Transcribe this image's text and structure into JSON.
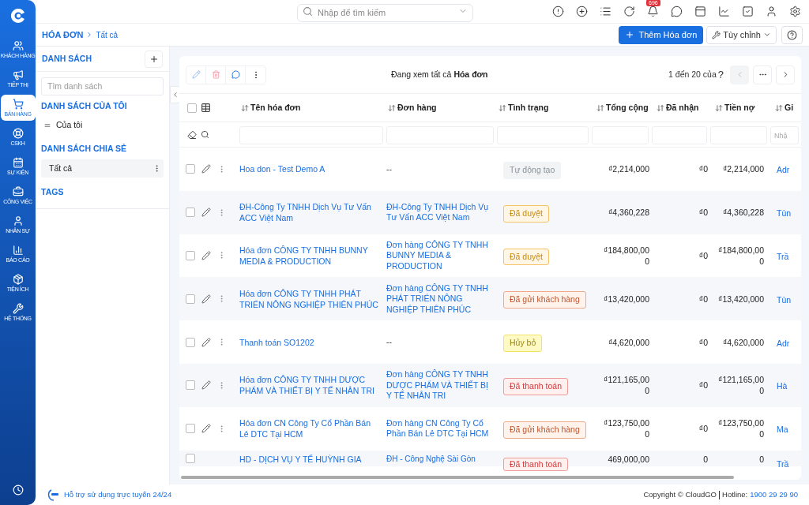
{
  "nav": [
    {
      "label": "KHÁCH HÀNG",
      "selected": false
    },
    {
      "label": "TIẾP THỊ",
      "selected": false
    },
    {
      "label": "BÁN HÀNG",
      "selected": true
    },
    {
      "label": "CSKH",
      "selected": false
    },
    {
      "label": "SỰ KIỆN",
      "selected": false
    },
    {
      "label": "CÔNG VIỆC",
      "selected": false
    },
    {
      "label": "NHÂN SỰ",
      "selected": false
    },
    {
      "label": "BÁO CÁO",
      "selected": false
    },
    {
      "label": "TIỆN ÍCH",
      "selected": false
    },
    {
      "label": "HỆ THỐNG",
      "selected": false
    }
  ],
  "search": {
    "placeholder": "Nhập để tìm kiếm"
  },
  "notification_count": "696",
  "breadcrumb": {
    "module": "HÓA ĐƠN",
    "current": "Tất cả"
  },
  "actions": {
    "add": "Thêm Hóa đơn",
    "customize": "Tùy chỉnh"
  },
  "lists_panel": {
    "title": "DANH SÁCH",
    "search_placeholder": "Tìm danh sách",
    "sections": [
      {
        "title": "DANH SÁCH CỦA TÔI",
        "items": [
          {
            "label": "Của tôi",
            "selected": false
          }
        ]
      },
      {
        "title": "DANH SÁCH CHIA SẺ",
        "items": [
          {
            "label": "Tất cả",
            "selected": true
          }
        ]
      },
      {
        "title": "TAGS"
      }
    ]
  },
  "toolbar": {
    "viewing": "Đang xem tất cả **Hóa đơn**",
    "range": "1 đến 20 của",
    "total": "?"
  },
  "table": {
    "columns": [
      "Tên hóa đơn",
      "Đơn hàng",
      "Tình trạng",
      "Tổng cộng",
      "Đã nhận",
      "Tiền nợ",
      "Gi"
    ],
    "last_filter_placeholder": "Nhậ",
    "all_checked": false,
    "rows": [
      {
        "name": "Hoa don - Test Demo A",
        "order": "--",
        "status": {
          "label": "Tự động tạo",
          "kind": "auto"
        },
        "total": "₫2,214,000",
        "received": "₫0",
        "debt": "₫2,214,000",
        "column_8": "Adr",
        "checked": false
      },
      {
        "name": "ĐH-Công Ty TNHH Dịch Vụ Tư Vấn ACC Việt Nam",
        "order": "ĐH-Công Ty TNHH Dịch Vụ Tư Vấn ACC Việt Nam",
        "status": {
          "label": "Đã duyệt",
          "kind": "approved"
        },
        "total": "₫4,360,228",
        "received": "₫0",
        "debt": "₫4,360,228",
        "column_8": "Tùn",
        "checked": false
      },
      {
        "name": "Hóa đơn CÔNG TY TNHH BUNNY MEDIA & PRODUCTION",
        "order": "Đơn hàng CÔNG TY TNHH BUNNY MEDIA & PRODUCTION",
        "status": {
          "label": "Đã duyệt",
          "kind": "approved"
        },
        "total": "₫184,800,000",
        "received": "₫0",
        "debt": "₫184,800,000",
        "column_8": "Trầ",
        "checked": false
      },
      {
        "name": "Hóa đơn CÔNG TY TNHH PHÁT TRIỂN NÔNG NGHIỆP THIÊN PHÚC",
        "order": "Đơn hàng CÔNG TY TNHH PHÁT TRIỂN NÔNG NGHIỆP THIÊN PHÚC",
        "status": {
          "label": "Đã gửi khách hàng",
          "kind": "sent"
        },
        "total": "₫13,420,000",
        "received": "₫0",
        "debt": "₫13,420,000",
        "column_8": "Tùn",
        "checked": false
      },
      {
        "name": "Thanh toán SO1202",
        "order": "--",
        "status": {
          "label": "Hủy bỏ",
          "kind": "cancelled"
        },
        "total": "₫4,620,000",
        "received": "₫0",
        "debt": "₫4,620,000",
        "column_8": "Adr",
        "checked": false
      },
      {
        "name": "Hóa đơn CÔNG TY TNHH DƯỢC PHẨM VÀ THIẾT BỊ Y TẾ NHÂN TRI",
        "order": "Đơn hàng CÔNG TY TNHH DƯỢC PHẨM VÀ THIẾT BỊ Y TẾ NHÂN TRI",
        "status": {
          "label": "Đã thanh toán",
          "kind": "paid"
        },
        "total": "₫121,165,000",
        "received": "₫0",
        "debt": "₫121,165,000",
        "column_8": "Hà",
        "checked": false
      },
      {
        "name": "Hóa đơn CN Công Ty Cổ Phần Bán Lẻ DTC Tại HCM",
        "order": "Đơn hàng CN Công Ty Cổ Phần Bán Lẻ DTC Tại HCM",
        "status": {
          "label": "Đã gửi khách hàng",
          "kind": "sent"
        },
        "total": "₫123,750,000",
        "received": "₫0",
        "debt": "₫123,750,000",
        "column_8": "Ma",
        "checked": false
      },
      {
        "name": "HD - DỊCH VỤ Y TẾ HUỲNH GIA",
        "order": "ĐH - Công Nghệ Sài Gòn",
        "status": {
          "label": "Đã thanh toán",
          "kind": "paid"
        },
        "total": "469,000,00",
        "received": "0",
        "debt": "0",
        "column_8": "Trầ",
        "checked": false
      }
    ]
  },
  "footer": {
    "support": "Hỗ trợ sử dụng trực tuyến 24/24",
    "copyright": "Copyright © CloudGO",
    "hotline_label": "Hotline:",
    "hotline": "1900 29 29 90"
  }
}
